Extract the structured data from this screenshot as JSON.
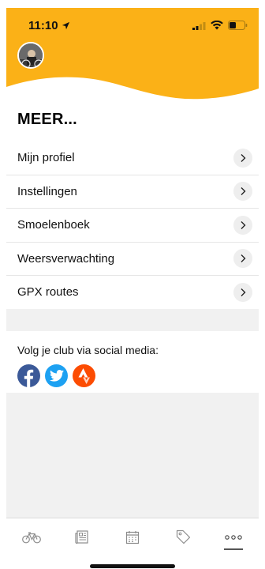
{
  "status_bar": {
    "time": "11:10"
  },
  "page": {
    "title": "MEER..."
  },
  "menu": {
    "items": [
      {
        "label": "Mijn profiel"
      },
      {
        "label": "Instellingen"
      },
      {
        "label": "Smoelenboek"
      },
      {
        "label": "Weersverwachting"
      },
      {
        "label": "GPX routes"
      }
    ]
  },
  "social": {
    "heading": "Volg je club via social media:",
    "icons": [
      "facebook-icon",
      "twitter-icon",
      "strava-icon"
    ]
  },
  "tabbar": {
    "tabs": [
      "bike-icon",
      "news-icon",
      "calendar-icon",
      "tag-icon",
      "more-icon"
    ],
    "active": "more-icon"
  },
  "colors": {
    "header": "#FBB117",
    "facebook": "#3B5998",
    "twitter": "#1DA1F2",
    "strava": "#FC4C02",
    "band": "#F1F1F1"
  }
}
